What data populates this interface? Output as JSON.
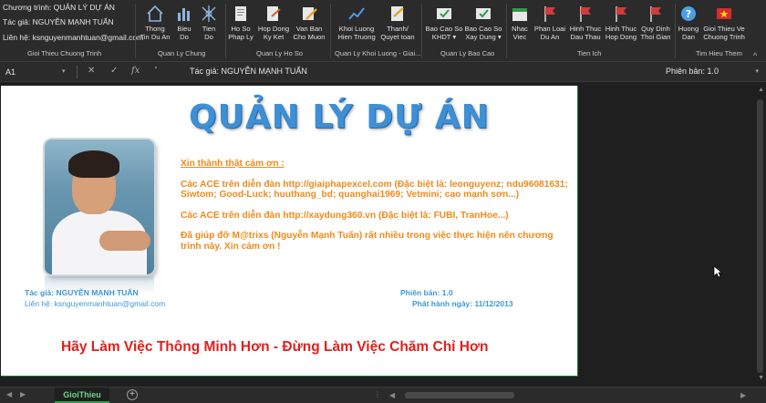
{
  "ribbon": {
    "info": {
      "program": "Chương trình: QUẢN LÝ DỰ ÁN",
      "author": "Tác giả: NGUYỄN MẠNH TUẤN",
      "contact": "Liên hệ: ksnguyenmanhtuan@gmail.com",
      "group_label": "Gioi Thieu Chuong Trinh"
    },
    "groups": [
      {
        "label": "Quan Ly Chung"
      },
      {
        "label": "Quan Ly Ho So"
      },
      {
        "label": "Quan Ly Khoi Luong - Giai..."
      },
      {
        "label": "Quan Ly Bao Cao"
      },
      {
        "label": "Tien Ich"
      },
      {
        "label": "Tim Hieu Them"
      }
    ],
    "buttons": [
      {
        "label": "Thong\nTin Du An",
        "icon": "house-icon"
      },
      {
        "label": "Bieu\nDo",
        "icon": "bar-chart-icon"
      },
      {
        "label": "Tien\nDo",
        "icon": "network-icon"
      },
      {
        "label": "Ho So\nPhap Ly",
        "icon": "document-icon"
      },
      {
        "label": "Hop Dong\nKy Ket",
        "icon": "contract-icon"
      },
      {
        "label": "Van Ban\nCho Muon",
        "icon": "pencil-icon"
      },
      {
        "label": "Khoi Luong\nHien Truong",
        "icon": "line-chart-icon"
      },
      {
        "label": "Thanh/\nQuyet toan",
        "icon": "signature-icon"
      },
      {
        "label": "Bao Cao So\nKHDT ▾",
        "icon": "report-check-icon"
      },
      {
        "label": "Bao Cao So\nXay Dung ▾",
        "icon": "report-check-icon"
      },
      {
        "label": "Nhac\nViec",
        "icon": "calendar-icon"
      },
      {
        "label": "Phan Loai\nDu An",
        "icon": "flag-icon"
      },
      {
        "label": "Hinh Thuc\nDau Thau",
        "icon": "flag-icon"
      },
      {
        "label": "Hinh Thuc\nHop Dong",
        "icon": "flag-icon"
      },
      {
        "label": "Quy Dinh\nThoi Gian",
        "icon": "flag-icon"
      },
      {
        "label": "Huong\nDan",
        "icon": "help-icon"
      },
      {
        "label": "Gioi Thieu Ve\nChuong Trinh",
        "icon": "star-flag-icon"
      }
    ]
  },
  "formula_bar": {
    "cell_ref": "A1",
    "apostrophe": "'",
    "content": "Tác giả: NGUYỄN MẠNH TUẤN",
    "version": "Phiên bản: 1.0"
  },
  "card": {
    "title": "QUẢN LÝ DỰ ÁN",
    "thanks_head": "Xin thành thật cảm ơn :",
    "thanks_1": "Các ACE trên diễn đàn http://giaiphapexcel.com (Đặc biệt là: leonguyenz; ndu96081631; Siwtom; Good-Luck; huuthang_bd; quanghai1969; Vetmini; cao mạnh sơn...)",
    "thanks_2": "Các ACE trên diễn đàn http://xaydung360.vn (Đặc biệt là: FUBI, TranHoe...)",
    "thanks_3": "Đã giúp đỡ M@trixs (Nguyễn Mạnh Tuấn) rất nhiều trong việc thực hiện nên chương trình này. Xin cảm ơn !",
    "author": "Tác giả: NGUYỄN MẠNH TUẤN",
    "contact": "Liên hệ: ksnguyenmanhtuan@gmail.com",
    "version": "Phiên bản: 1.0",
    "release": "Phát hành ngày: 11/12/2013",
    "slogan": "Hãy Làm Việc Thông Minh Hơn - Đừng Làm Việc Chăm Chỉ Hơn"
  },
  "tabs": {
    "sheet": "GioiThieu",
    "add": "+"
  },
  "colors": {
    "accent_green": "#2f9c4c",
    "title_blue": "#3d8fd6",
    "thanks_orange": "#ee8a1c",
    "slogan_red": "#e0201d"
  }
}
